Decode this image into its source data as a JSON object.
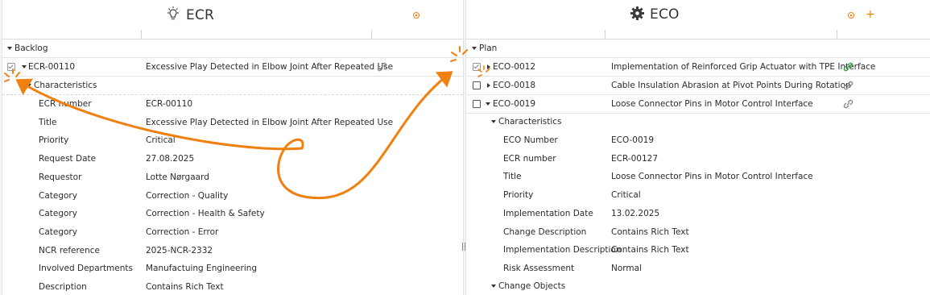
{
  "colors": {
    "accent": "#f08010",
    "link_green": "#2ea043",
    "link_gray": "#8a8a8a"
  },
  "left": {
    "title": "ECR",
    "title_icon": "lightbulb-icon",
    "group": "Backlog",
    "item": {
      "id": "ECR-00110",
      "title": "Excessive Play Detected in Elbow Joint After Repeated Use"
    },
    "section": "Characteristics",
    "fields": [
      {
        "label": "ECR number",
        "value": "ECR-00110"
      },
      {
        "label": "Title",
        "value": "Excessive Play Detected in Elbow Joint After Repeated Use"
      },
      {
        "label": "Priority",
        "value": "Critical"
      },
      {
        "label": "Request Date",
        "value": "27.08.2025"
      },
      {
        "label": "Requestor",
        "value": "Lotte Nørgaard"
      },
      {
        "label": "Category",
        "value": "Correction - Quality"
      },
      {
        "label": "Category",
        "value": "Correction - Health & Safety"
      },
      {
        "label": "Category",
        "value": "Correction - Error"
      },
      {
        "label": "NCR reference",
        "value": "2025-NCR-2332"
      },
      {
        "label": "Involved Departments",
        "value": "Manufactuing Engineering"
      },
      {
        "label": "Description",
        "value": "Contains Rich Text"
      }
    ]
  },
  "right": {
    "title": "ECO",
    "title_icon": "gear-icon",
    "add_label": "+",
    "group": "Plan",
    "items": [
      {
        "id": "ECO-0012",
        "title": "Implementation of Reinforced Grip Actuator with TPE Interface"
      },
      {
        "id": "ECO-0018",
        "title": "Cable Insulation Abrasion at Pivot Points During Rotation"
      },
      {
        "id": "ECO-0019",
        "title": "Loose Connector Pins in Motor Control Interface"
      }
    ],
    "section": "Characteristics",
    "fields": [
      {
        "label": "ECO Number",
        "value": "ECO-0019"
      },
      {
        "label": "ECR number",
        "value": "ECR-00127"
      },
      {
        "label": "Title",
        "value": "Loose Connector Pins in Motor Control Interface"
      },
      {
        "label": "Priority",
        "value": "Critical"
      },
      {
        "label": "Implementation Date",
        "value": "13.02.2025"
      },
      {
        "label": "Change Description",
        "value": "Contains Rich Text"
      },
      {
        "label": "Implementation Description",
        "value": "Contains Rich Text"
      },
      {
        "label": "Risk Assessment",
        "value": "Normal"
      }
    ],
    "section2": "Change Objects"
  }
}
